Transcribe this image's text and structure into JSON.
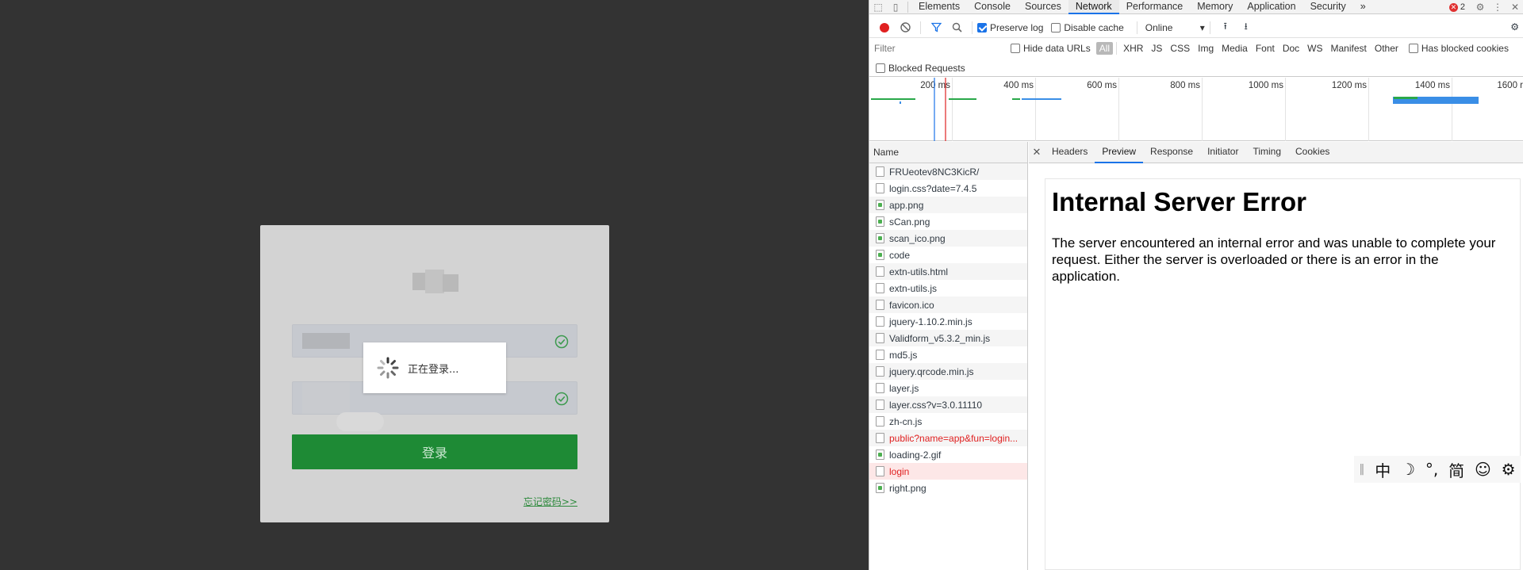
{
  "page": {
    "loading_text": "正在登录...",
    "login_button": "登录",
    "forgot_link": "忘记密码>>"
  },
  "devtools": {
    "tabs": [
      "Elements",
      "Console",
      "Sources",
      "Network",
      "Performance",
      "Memory",
      "Application",
      "Security"
    ],
    "active_tab": "Network",
    "more_tabs": "»",
    "error_count": "2",
    "toolbar": {
      "preserve_log": "Preserve log",
      "disable_cache": "Disable cache",
      "throttle": "Online"
    },
    "filter": {
      "placeholder": "Filter",
      "hide_data_urls": "Hide data URLs",
      "types": [
        "All",
        "XHR",
        "JS",
        "CSS",
        "Img",
        "Media",
        "Font",
        "Doc",
        "WS",
        "Manifest",
        "Other"
      ],
      "has_blocked_cookies": "Has blocked cookies",
      "blocked_requests": "Blocked Requests"
    },
    "overview_ticks": [
      "200 ms",
      "400 ms",
      "600 ms",
      "800 ms",
      "1000 ms",
      "1200 ms",
      "1400 ms",
      "1600 r"
    ],
    "name_header": "Name",
    "requests": [
      {
        "name": "FRUeotev8NC3KicR/",
        "kind": "doc"
      },
      {
        "name": "login.css?date=7.4.5",
        "kind": "doc"
      },
      {
        "name": "app.png",
        "kind": "img"
      },
      {
        "name": "sCan.png",
        "kind": "img"
      },
      {
        "name": "scan_ico.png",
        "kind": "img"
      },
      {
        "name": "code",
        "kind": "img"
      },
      {
        "name": "extn-utils.html",
        "kind": "doc"
      },
      {
        "name": "extn-utils.js",
        "kind": "doc"
      },
      {
        "name": "favicon.ico",
        "kind": "doc"
      },
      {
        "name": "jquery-1.10.2.min.js",
        "kind": "doc"
      },
      {
        "name": "Validform_v5.3.2_min.js",
        "kind": "doc"
      },
      {
        "name": "md5.js",
        "kind": "doc"
      },
      {
        "name": "jquery.qrcode.min.js",
        "kind": "doc"
      },
      {
        "name": "layer.js",
        "kind": "doc"
      },
      {
        "name": "layer.css?v=3.0.11110",
        "kind": "doc"
      },
      {
        "name": "zh-cn.js",
        "kind": "doc"
      },
      {
        "name": "public?name=app&fun=login...",
        "kind": "error"
      },
      {
        "name": "loading-2.gif",
        "kind": "img"
      },
      {
        "name": "login",
        "kind": "error-selected"
      },
      {
        "name": "right.png",
        "kind": "img"
      }
    ],
    "detail_tabs": [
      "Headers",
      "Preview",
      "Response",
      "Initiator",
      "Timing",
      "Cookies"
    ],
    "active_detail_tab": "Preview",
    "preview": {
      "heading": "Internal Server Error",
      "body": "The server encountered an internal error and was unable to complete your request. Either the server is overloaded or there is an error in the application."
    }
  },
  "ime_toolbar": [
    "中",
    "☽",
    "°,",
    "简",
    "☺",
    "⚙"
  ],
  "colors": {
    "accent": "#1a73e8",
    "login_button": "#1e8a35",
    "error_text": "#e02020",
    "record": "#e02020"
  }
}
